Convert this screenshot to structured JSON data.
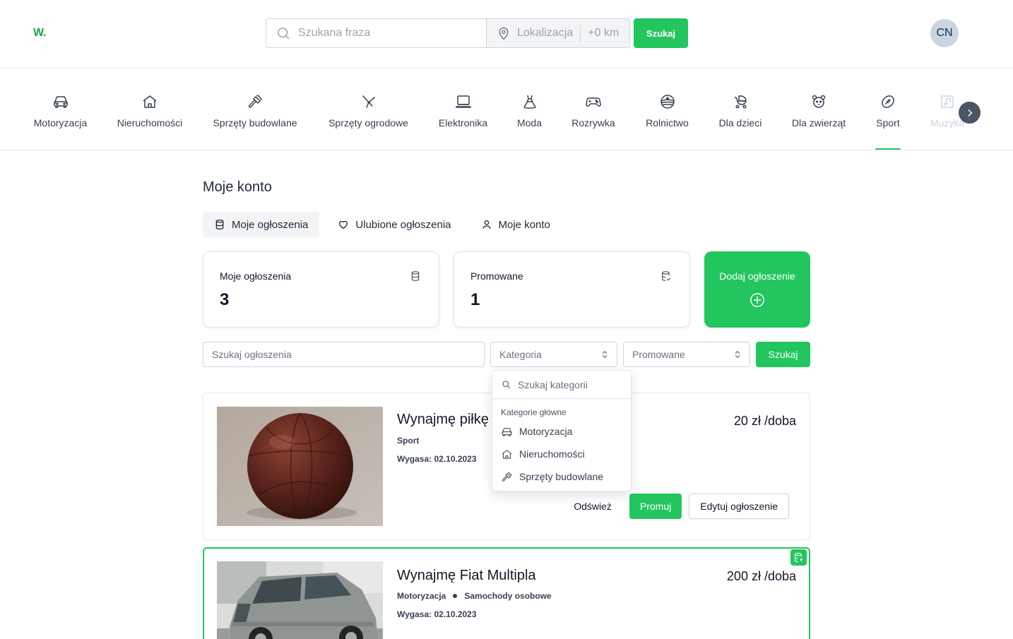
{
  "header": {
    "logo": "W.",
    "search_placeholder": "Szukana fraza",
    "location_placeholder": "Lokalizacja",
    "radius": "+0 km",
    "search_button": "Szukaj",
    "avatar_initials": "CN"
  },
  "categories": [
    {
      "label": "Motoryzacja",
      "icon": "car-icon"
    },
    {
      "label": "Nieruchomości",
      "icon": "house-icon"
    },
    {
      "label": "Sprzęty budowlane",
      "icon": "hammer-icon"
    },
    {
      "label": "Sprzęty ogrodowe",
      "icon": "garden-shears-icon"
    },
    {
      "label": "Elektronika",
      "icon": "laptop-icon"
    },
    {
      "label": "Moda",
      "icon": "dress-icon"
    },
    {
      "label": "Rozrywka",
      "icon": "gamepad-icon"
    },
    {
      "label": "Rolnictwo",
      "icon": "field-icon"
    },
    {
      "label": "Dla dzieci",
      "icon": "stroller-icon"
    },
    {
      "label": "Dla zwierząt",
      "icon": "pet-icon"
    },
    {
      "label": "Sport",
      "icon": "ball-icon",
      "active": true
    },
    {
      "label": "Muzyka",
      "icon": "music-icon"
    }
  ],
  "account": {
    "title": "Moje konto",
    "tabs": [
      {
        "label": "Moje ogłoszenia",
        "icon": "database-icon",
        "active": true
      },
      {
        "label": "Ulubione ogłoszenia",
        "icon": "heart-icon"
      },
      {
        "label": "Moje konto",
        "icon": "user-icon"
      }
    ],
    "stats": [
      {
        "label": "Moje ogłoszenia",
        "value": "3",
        "icon": "database-icon"
      },
      {
        "label": "Promowane",
        "value": "1",
        "icon": "database-check-icon"
      }
    ],
    "add_label": "Dodaj ogłoszenie"
  },
  "filters": {
    "search_placeholder": "Szukaj ogłoszenia",
    "category_placeholder": "Kategoria",
    "promoted_placeholder": "Promowane",
    "search_button": "Szukaj"
  },
  "category_dropdown": {
    "search_placeholder": "Szukaj kategorii",
    "group_label": "Kategorie główne",
    "items": [
      "Motoryzacja",
      "Nieruchomości",
      "Sprzęty budowlane"
    ]
  },
  "listings": [
    {
      "title": "Wynajmę piłkę",
      "price": "20 zł /doba",
      "tags": [
        "Sport"
      ],
      "expires": "Wygasa: 02.10.2023",
      "actions": {
        "refresh": "Odśwież",
        "promote": "Promuj",
        "edit": "Edytuj ogłoszenie"
      }
    },
    {
      "title": "Wynajmę Fiat Multipla",
      "price": "200 zł /doba",
      "tags": [
        "Motoryzacja",
        "Samochody osobowe"
      ],
      "expires": "Wygasa: 02.10.2023",
      "promoted": true
    }
  ],
  "colors": {
    "accent": "#22c55e",
    "text": "#111827",
    "border": "#e5e7eb"
  }
}
